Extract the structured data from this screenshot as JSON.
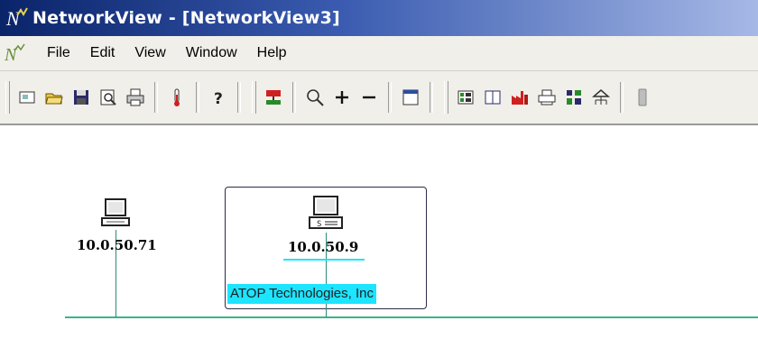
{
  "window": {
    "title": "NetworkView - [NetworkView3]"
  },
  "menu": {
    "items": [
      "File",
      "Edit",
      "View",
      "Window",
      "Help"
    ]
  },
  "toolbar": {
    "groups": [
      [
        "new-icon",
        "open-icon",
        "save-icon",
        "print-preview-icon",
        "print-icon",
        "thermometer-icon",
        "help-icon"
      ],
      [
        "network-map-icon",
        "zoom-icon",
        "zoom-in-icon",
        "zoom-out-icon",
        "window-icon"
      ],
      [
        "device-list-icon",
        "book-icon",
        "factory-icon",
        "printer-icon",
        "group-icon",
        "tree-icon",
        "battery-icon"
      ]
    ]
  },
  "canvas": {
    "nodes": [
      {
        "ip": "10.0.50.71",
        "icon": "computer-icon",
        "selected": false
      },
      {
        "ip": "10.0.50.9",
        "icon": "server-icon",
        "selected": true,
        "organization": "ATOP Technologies, Inc"
      }
    ],
    "colors": {
      "bus": "#3cb48a",
      "highlight": "#1de4ff",
      "titlebar": "#0a246a"
    }
  }
}
